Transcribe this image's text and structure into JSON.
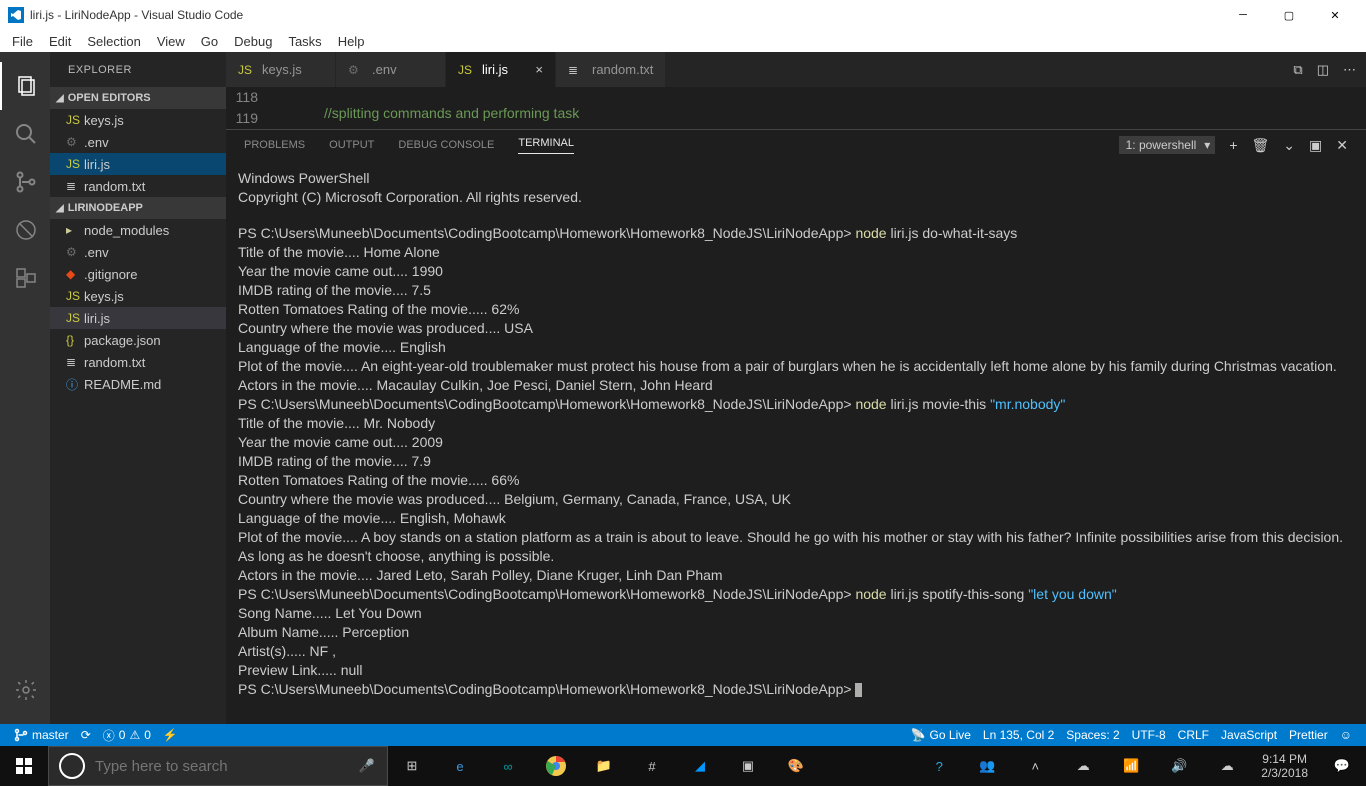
{
  "window": {
    "title": "liri.js - LiriNodeApp - Visual Studio Code"
  },
  "menu": [
    "File",
    "Edit",
    "Selection",
    "View",
    "Go",
    "Debug",
    "Tasks",
    "Help"
  ],
  "sidebar": {
    "header": "EXPLORER",
    "sec1": "OPEN EDITORS",
    "open": [
      {
        "icon": "JS",
        "label": "keys.js"
      },
      {
        "icon": "⚙",
        "label": ".env"
      },
      {
        "icon": "JS",
        "label": "liri.js",
        "sel": true
      },
      {
        "icon": "≣",
        "label": "random.txt"
      }
    ],
    "sec2": "LIRINODEAPP",
    "project": [
      {
        "icon": "▸",
        "label": "node_modules",
        "indent": 0
      },
      {
        "icon": "⚙",
        "label": ".env"
      },
      {
        "icon": "◆",
        "label": ".gitignore"
      },
      {
        "icon": "JS",
        "label": "keys.js"
      },
      {
        "icon": "JS",
        "label": "liri.js",
        "act": true
      },
      {
        "icon": "{}",
        "label": "package.json"
      },
      {
        "icon": "≣",
        "label": "random.txt"
      },
      {
        "icon": "ⓘ",
        "label": "README.md"
      }
    ]
  },
  "tabs": [
    {
      "icon": "JS",
      "label": "keys.js"
    },
    {
      "icon": "⚙",
      "label": ".env"
    },
    {
      "icon": "JS",
      "label": "liri.js",
      "active": true
    },
    {
      "icon": "≣",
      "label": "random.txt"
    }
  ],
  "code": {
    "lines": [
      "118",
      "119"
    ],
    "text": "//splitting commands and performing task"
  },
  "panel": {
    "tabs": [
      "PROBLEMS",
      "OUTPUT",
      "DEBUG CONSOLE",
      "TERMINAL"
    ],
    "active": 3,
    "select": "1: powershell",
    "term": {
      "l1": "Windows PowerShell",
      "l2": "Copyright (C) Microsoft Corporation. All rights reserved.",
      "p": "PS C:\\Users\\Muneeb\\Documents\\CodingBootcamp\\Homework\\Homework8_NodeJS\\LiriNodeApp> ",
      "cmd1a": "node",
      "cmd1b": " liri.js do-what-it-says",
      "o1": "Title of the movie.... Home Alone",
      "o2": "Year the movie came out.... 1990",
      "o3": "IMDB rating of the movie.... 7.5",
      "o4": "Rotten Tomatoes Rating of the movie..... 62%",
      "o5": "Country where the movie was produced.... USA",
      "o6": "Language of the movie.... English",
      "o7": "Plot of the movie.... An eight-year-old troublemaker must protect his house from a pair of burglars when he is accidentally left home alone by his family during Christmas vacation.",
      "o8": "Actors in the movie.... Macaulay Culkin, Joe Pesci, Daniel Stern, John Heard",
      "cmd2b": " liri.js movie-this ",
      "cmd2c": "\"mr.nobody\"",
      "o9": "Title of the movie.... Mr. Nobody",
      "o10": "Year the movie came out.... 2009",
      "o11": "IMDB rating of the movie.... 7.9",
      "o12": "Rotten Tomatoes Rating of the movie..... 66%",
      "o13": "Country where the movie was produced.... Belgium, Germany, Canada, France, USA, UK",
      "o14": "Language of the movie.... English, Mohawk",
      "o15": "Plot of the movie.... A boy stands on a station platform as a train is about to leave. Should he go with his mother or stay with his father? Infinite possibilities arise from this decision. As long as he doesn't choose, anything is possible.",
      "o16": "Actors in the movie.... Jared Leto, Sarah Polley, Diane Kruger, Linh Dan Pham",
      "cmd3b": " liri.js spotify-this-song ",
      "cmd3c": "\"let you down\"",
      "o17": "Song Name..... Let You Down",
      "o18": "Album Name..... Perception",
      "o19": "Artist(s)..... NF ,",
      "o20": "Preview Link..... null"
    }
  },
  "status": {
    "branch": "master",
    "errors": "0",
    "warn": "0",
    "golive": "Go Live",
    "pos": "Ln 135, Col 2",
    "spaces": "Spaces: 2",
    "enc": "UTF-8",
    "eol": "CRLF",
    "lang": "JavaScript",
    "prettier": "Prettier"
  },
  "taskbar": {
    "search": "Type here to search",
    "time": "9:14 PM",
    "date": "2/3/2018"
  }
}
